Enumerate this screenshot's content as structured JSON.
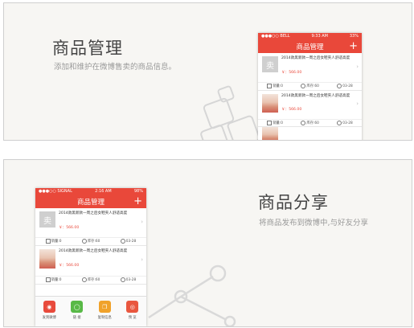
{
  "panel_top": {
    "title": "商品管理",
    "subtitle": "添加和维护在微博售卖的商品信息。",
    "phone": {
      "status_left": "●●●○○ BELL",
      "status_time": "9:33 AM",
      "status_battery": "33%",
      "nav_title": "商品管理",
      "nav_add": "+",
      "items": [
        {
          "thumb": "卖",
          "title": "2014款黑新款一周之后女鞋夹人舒适高度",
          "price": "￥：566.00",
          "sales": "销量:0",
          "stock": "库存:60",
          "date": "03-28"
        },
        {
          "title": "2014款黑新款一周之后女鞋夹人舒适高度",
          "price": "￥：566.00",
          "sales": "销量:0",
          "stock": "库存:60",
          "date": "03-28"
        }
      ]
    }
  },
  "panel_bottom": {
    "title": "商品分享",
    "subtitle": "将商品发布到微博中,与好友分享",
    "phone": {
      "status_left": "●●●○○ SIGNAL",
      "status_time": "2:16 AM",
      "status_battery": "98%",
      "nav_title": "商品管理",
      "nav_add": "+",
      "items": [
        {
          "thumb": "卖",
          "title": "2014款黑新款一周之后女鞋夹人舒适高度",
          "price": "￥：566.00",
          "sales": "销量:0",
          "stock": "库存:60",
          "date": "03-28"
        },
        {
          "title": "2014款黑新款一周之后女鞋夹人舒适高度",
          "price": "￥：566.00",
          "sales": "销量:0",
          "stock": "库存:60",
          "date": "03-28"
        }
      ],
      "toolbar": [
        {
          "label": "发到微博",
          "color": "#e84a3c"
        },
        {
          "label": "链 接",
          "color": "#58b947"
        },
        {
          "label": "复制信息",
          "color": "#f0a22a"
        },
        {
          "label": "预 览",
          "color": "#e9573f"
        }
      ]
    }
  },
  "colors": {
    "accent": "#e9483a"
  }
}
